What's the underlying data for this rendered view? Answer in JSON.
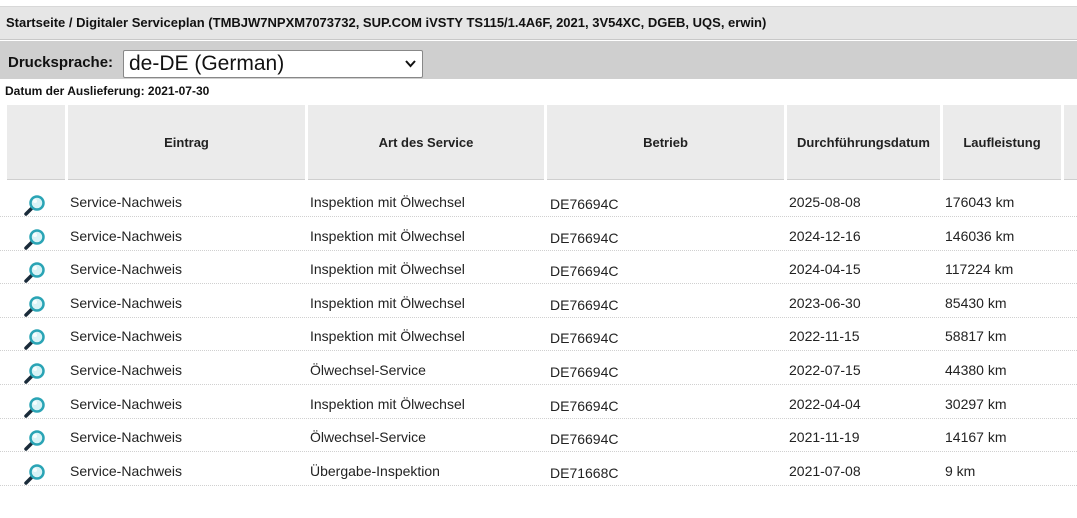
{
  "breadcrumb": "Startseite / Digitaler Serviceplan (TMBJW7NPXM7073732, SUP.COM iVSTY TS115/1.4A6F, 2021, 3V54XC, DGEB, UQS, erwin)",
  "print_language": {
    "label": "Drucksprache:",
    "selected": "de-DE (German)"
  },
  "delivery_date": "Datum der Auslieferung: 2021-07-30",
  "table": {
    "headers": {
      "entry": "Eintrag",
      "service_type": "Art des Service",
      "dealer": "Betrieb",
      "date": "Durchführungsdatum",
      "mileage": "Laufleistung"
    },
    "rows": [
      {
        "entry": "Service-Nachweis",
        "service_type": "Inspektion mit Ölwechsel",
        "dealer": "DE76694C",
        "date": "2025-08-08",
        "mileage": "176043 km"
      },
      {
        "entry": "Service-Nachweis",
        "service_type": "Inspektion mit Ölwechsel",
        "dealer": "DE76694C",
        "date": "2024-12-16",
        "mileage": "146036 km"
      },
      {
        "entry": "Service-Nachweis",
        "service_type": "Inspektion mit Ölwechsel",
        "dealer": "DE76694C",
        "date": "2024-04-15",
        "mileage": "117224 km"
      },
      {
        "entry": "Service-Nachweis",
        "service_type": "Inspektion mit Ölwechsel",
        "dealer": "DE76694C",
        "date": "2023-06-30",
        "mileage": "85430 km"
      },
      {
        "entry": "Service-Nachweis",
        "service_type": "Inspektion mit Ölwechsel",
        "dealer": "DE76694C",
        "date": "2022-11-15",
        "mileage": "58817 km"
      },
      {
        "entry": "Service-Nachweis",
        "service_type": "Ölwechsel-Service",
        "dealer": "DE76694C",
        "date": "2022-07-15",
        "mileage": "44380 km"
      },
      {
        "entry": "Service-Nachweis",
        "service_type": "Inspektion mit Ölwechsel",
        "dealer": "DE76694C",
        "date": "2022-04-04",
        "mileage": "30297 km"
      },
      {
        "entry": "Service-Nachweis",
        "service_type": "Ölwechsel-Service",
        "dealer": "DE76694C",
        "date": "2021-11-19",
        "mileage": "14167 km"
      },
      {
        "entry": "Service-Nachweis",
        "service_type": "Übergabe-Inspektion",
        "dealer": "DE71668C",
        "date": "2021-07-08",
        "mileage": "9 km"
      }
    ],
    "row_icon": "magnifier-icon"
  },
  "colors": {
    "header_bg": "#ebebeb",
    "breadcrumb_bg": "#e6e6e6",
    "langbar_bg": "#cfcfcf",
    "icon_lens": "#2aa4b5",
    "icon_handle": "#1a2b3a"
  }
}
